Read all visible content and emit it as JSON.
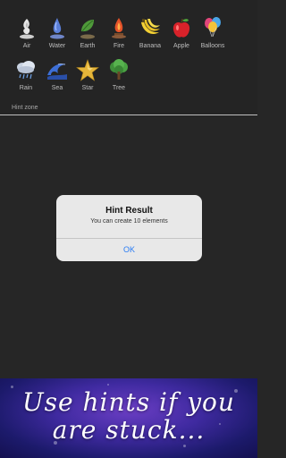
{
  "elements": [
    {
      "label": "Air",
      "icon": "air-icon"
    },
    {
      "label": "Water",
      "icon": "water-icon"
    },
    {
      "label": "Earth",
      "icon": "earth-icon"
    },
    {
      "label": "Fire",
      "icon": "fire-icon"
    },
    {
      "label": "Banana",
      "icon": "banana-icon"
    },
    {
      "label": "Apple",
      "icon": "apple-icon"
    },
    {
      "label": "Balloons",
      "icon": "balloons-icon"
    },
    {
      "label": "Rain",
      "icon": "rain-icon"
    },
    {
      "label": "Sea",
      "icon": "sea-icon"
    },
    {
      "label": "Star",
      "icon": "star-icon"
    },
    {
      "label": "Tree",
      "icon": "tree-icon"
    }
  ],
  "hint_zone": {
    "label": "Hint zone"
  },
  "alert": {
    "title": "Hint Result",
    "message": "You can create 10 elements",
    "ok_label": "OK"
  },
  "promo": {
    "line1": "Use hints if you",
    "line2": "are stuck..."
  },
  "colors": {
    "background": "#262626",
    "accent": "#2a7cf4"
  }
}
